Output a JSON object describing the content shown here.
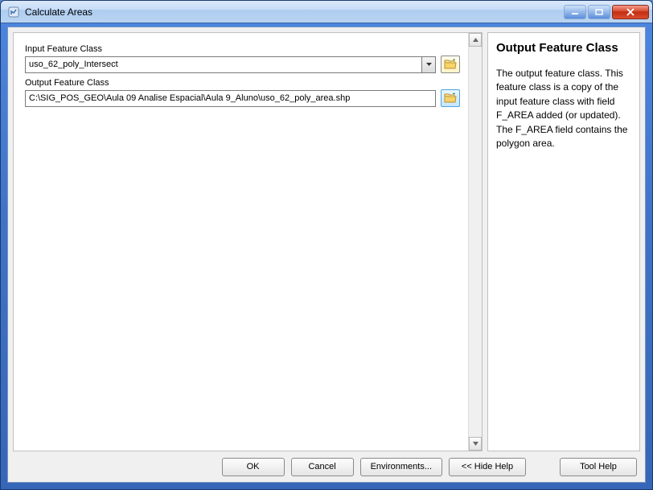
{
  "window": {
    "title": "Calculate Areas"
  },
  "form": {
    "input_label": "Input Feature Class",
    "input_value": "uso_62_poly_Intersect",
    "output_label": "Output Feature Class",
    "output_value": "C:\\SIG_POS_GEO\\Aula 09 Analise Espacial\\Aula 9_Aluno\\uso_62_poly_area.shp"
  },
  "help": {
    "title": "Output Feature Class",
    "body": "The output feature class. This feature class is a copy of the input feature class with field F_AREA added (or updated). The F_AREA field contains the polygon area."
  },
  "buttons": {
    "ok": "OK",
    "cancel": "Cancel",
    "environments": "Environments...",
    "hide_help": "<< Hide Help",
    "tool_help": "Tool Help"
  }
}
